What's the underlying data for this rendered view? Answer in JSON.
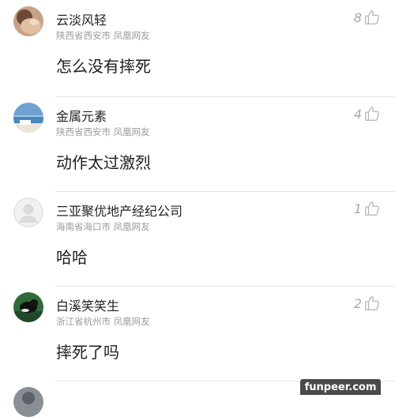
{
  "comments": [
    {
      "avatar_icon": "user-photo-icon",
      "username": "云淡风轻",
      "location": "陕西省西安市 凤凰网友",
      "content": "怎么没有摔死",
      "likes": "8"
    },
    {
      "avatar_icon": "beach-photo-icon",
      "username": "金属元素",
      "location": "陕西省西安市 凤凰网友",
      "content": "动作太过激烈",
      "likes": "4"
    },
    {
      "avatar_icon": "default-user-icon",
      "username": "三亚聚优地产经纪公司",
      "location": "海南省海口市 凤凰网友",
      "content": "哈哈",
      "likes": "1"
    },
    {
      "avatar_icon": "animal-photo-icon",
      "username": "白溪笑笑生",
      "location": "浙江省杭州市 凤凰网友",
      "content": "摔死了吗",
      "likes": "2"
    }
  ],
  "watermark": {
    "text": "funpeer.com"
  },
  "colors": {
    "username": "#222222",
    "location": "#9a9a9a",
    "content": "#1e1e1e",
    "like": "#a8a8a8",
    "divider": "#e6e6e6"
  }
}
